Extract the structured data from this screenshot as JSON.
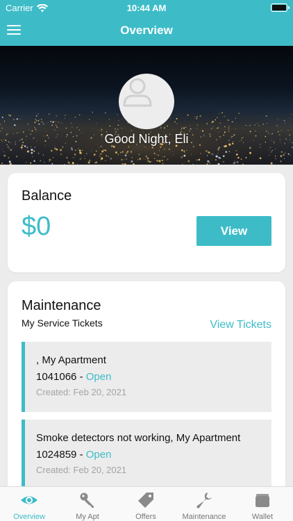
{
  "status_bar": {
    "carrier": "Carrier",
    "time": "10:44 AM"
  },
  "header": {
    "title": "Overview"
  },
  "hero": {
    "greeting": "Good Night, Eli"
  },
  "balance": {
    "title": "Balance",
    "amount": "$0",
    "view_label": "View"
  },
  "maintenance": {
    "title": "Maintenance",
    "subtitle": "My Service Tickets",
    "view_tickets_label": "View Tickets",
    "tickets": [
      {
        "title": ", My Apartment",
        "number": "1041066",
        "separator": " - ",
        "status": "Open",
        "created": "Created: Feb 20, 2021"
      },
      {
        "title": "Smoke detectors not working, My Apartment",
        "number": "1024859",
        "separator": " - ",
        "status": "Open",
        "created": "Created: Feb 20, 2021"
      }
    ]
  },
  "tabs": [
    {
      "label": "Overview",
      "icon": "eye-icon",
      "active": true
    },
    {
      "label": "My Apt",
      "icon": "key-icon",
      "active": false
    },
    {
      "label": "Offers",
      "icon": "tag-icon",
      "active": false
    },
    {
      "label": "Maintenance",
      "icon": "wrench-icon",
      "active": false
    },
    {
      "label": "Wallet",
      "icon": "wallet-icon",
      "active": false
    }
  ],
  "colors": {
    "accent": "#3dbcc8",
    "background": "#ececec",
    "card": "#ffffff",
    "muted": "#a3a3a3"
  }
}
